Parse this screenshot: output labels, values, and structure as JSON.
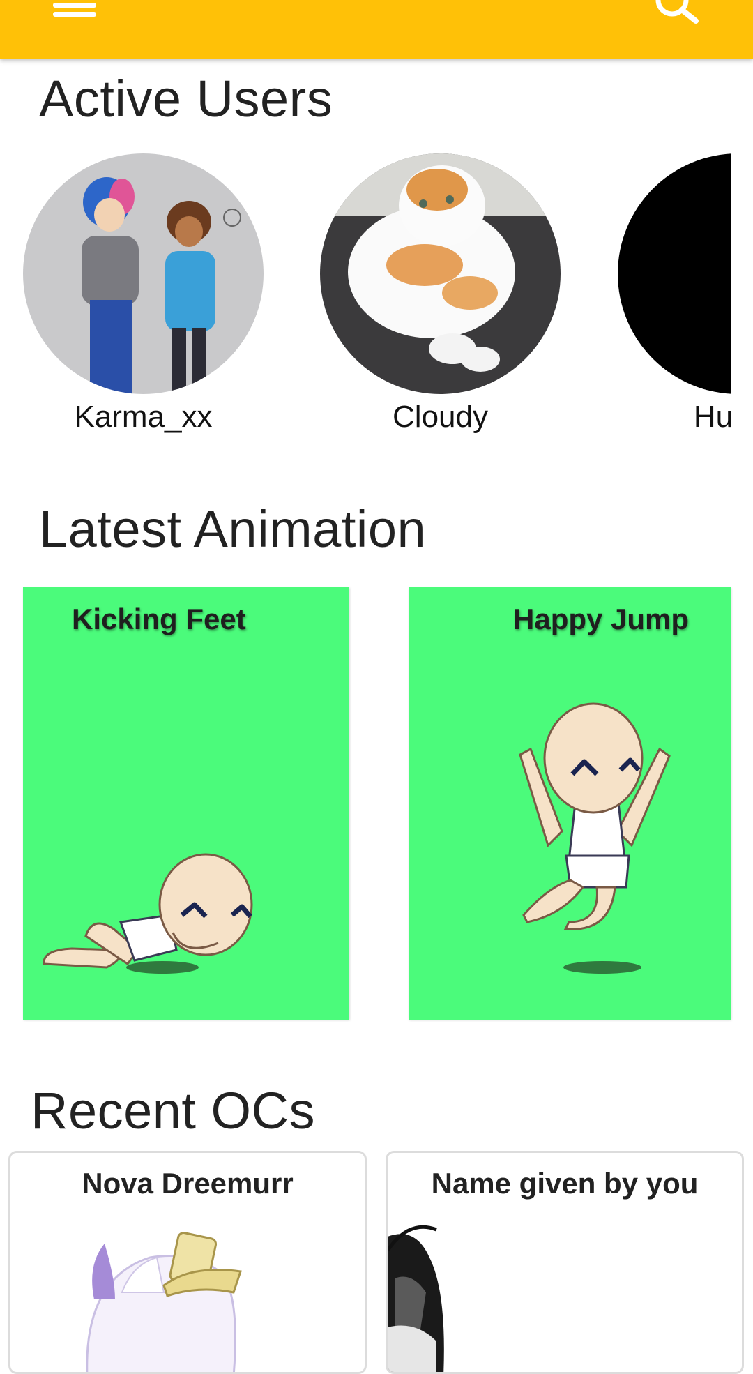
{
  "colors": {
    "appbar": "#FFC107",
    "animation_card_bg": "#4BFB7B",
    "heading_text": "#222222"
  },
  "header": {
    "menu_icon": "menu-icon",
    "search_icon": "search-icon"
  },
  "active_users": {
    "title": "Active Users",
    "users": [
      {
        "name": "Karma_xx"
      },
      {
        "name": "Cloudy"
      },
      {
        "name": "Hunny"
      }
    ]
  },
  "latest_animation": {
    "title": "Latest Animation",
    "items": [
      {
        "title": "Kicking Feet"
      },
      {
        "title": "Happy Jump"
      }
    ]
  },
  "recent_ocs": {
    "title": "Recent OCs",
    "items": [
      {
        "name": "Nova Dreemurr"
      },
      {
        "name": "Name given by you"
      }
    ]
  }
}
